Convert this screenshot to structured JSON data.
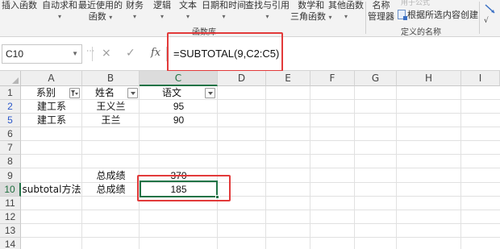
{
  "ribbon": {
    "buttons": [
      {
        "line1": "插入函数",
        "line2": ""
      },
      {
        "line1": "自动求和",
        "line2": "",
        "caret": "▾"
      },
      {
        "line1": "最近使用的",
        "line2": "函数",
        "caret": "▾"
      },
      {
        "line1": "财务",
        "line2": "",
        "caret": "▾"
      },
      {
        "line1": "逻辑",
        "line2": "",
        "caret": "▾"
      },
      {
        "line1": "文本",
        "line2": "",
        "caret": "▾"
      },
      {
        "line1": "日期和时间",
        "line2": "",
        "caret": "▾"
      },
      {
        "line1": "查找与引用",
        "line2": "",
        "caret": "▾"
      },
      {
        "line1": "数学和",
        "line2": "三角函数",
        "caret": "▾"
      },
      {
        "line1": "其他函数",
        "line2": "",
        "caret": "▾"
      },
      {
        "line1": "名称",
        "line2": "管理器"
      }
    ],
    "ghost_text": "用于公式",
    "create_from_selection": "根据所选内容创建",
    "group_function_library": "函数库",
    "group_defined_names": "定义的名称"
  },
  "formula_bar": {
    "name_box": "C10",
    "cancel_icon": "×",
    "enter_icon": "✓",
    "fx_label": "fx",
    "formula": "=SUBTOTAL(9,C2:C5)"
  },
  "grid": {
    "columns": [
      "A",
      "B",
      "C",
      "D",
      "E",
      "F",
      "G",
      "H",
      "I"
    ],
    "selected_column": "C",
    "rows": [
      "1",
      "2",
      "5",
      "6",
      "7",
      "8",
      "9",
      "10",
      "11",
      "12",
      "13",
      "14"
    ],
    "filtered_rows": [
      "2",
      "5"
    ],
    "selected_row": "10",
    "cells": {
      "A1": "系别",
      "B1": "姓名",
      "C1": "语文",
      "A2": "建工系",
      "B2": "王义兰",
      "C2": "95",
      "A5": "建工系",
      "B5": "王兰",
      "C5": "90",
      "B9": "总成绩",
      "C9": "370",
      "A10": "subtotal方法",
      "B10": "总成绩",
      "C10": "185"
    },
    "active_cell": "C10"
  },
  "colors": {
    "accent_green": "#217346",
    "annotation_red": "#e23a3a",
    "filtered_row_blue": "#2a57c9"
  }
}
